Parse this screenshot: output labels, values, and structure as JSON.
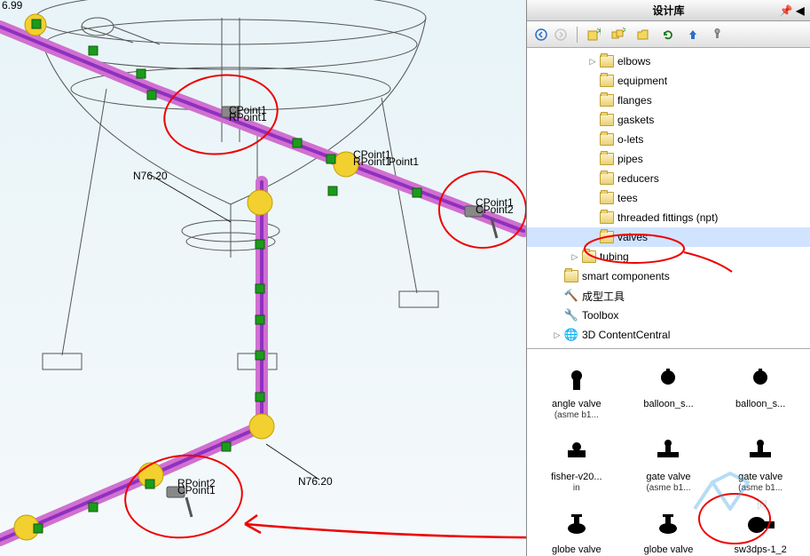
{
  "panel": {
    "title": "设计库",
    "toolbar_icons": [
      "back",
      "forward",
      "new-folder",
      "library",
      "open",
      "refresh",
      "up",
      "config"
    ]
  },
  "tree": [
    {
      "indent": 3,
      "expander": "▷",
      "icon": "folder",
      "label": "elbows"
    },
    {
      "indent": 3,
      "expander": "",
      "icon": "folder",
      "label": "equipment"
    },
    {
      "indent": 3,
      "expander": "",
      "icon": "folder",
      "label": "flanges"
    },
    {
      "indent": 3,
      "expander": "",
      "icon": "folder",
      "label": "gaskets"
    },
    {
      "indent": 3,
      "expander": "",
      "icon": "folder",
      "label": "o-lets"
    },
    {
      "indent": 3,
      "expander": "",
      "icon": "folder",
      "label": "pipes"
    },
    {
      "indent": 3,
      "expander": "",
      "icon": "folder",
      "label": "reducers"
    },
    {
      "indent": 3,
      "expander": "",
      "icon": "folder",
      "label": "tees"
    },
    {
      "indent": 3,
      "expander": "",
      "icon": "folder",
      "label": "threaded fittings (npt)"
    },
    {
      "indent": 3,
      "expander": "",
      "icon": "folder",
      "label": "valves",
      "selected": true
    },
    {
      "indent": 2,
      "expander": "▷",
      "icon": "folder",
      "label": "tubing"
    },
    {
      "indent": 1,
      "expander": "",
      "icon": "folder",
      "label": "smart components"
    },
    {
      "indent": 1,
      "expander": "",
      "icon": "forming",
      "label": "成型工具"
    },
    {
      "indent": 1,
      "expander": "",
      "icon": "toolbox",
      "label": "Toolbox"
    },
    {
      "indent": 1,
      "expander": "▷",
      "icon": "globe",
      "label": "3D ContentCentral"
    }
  ],
  "thumbs": [
    {
      "label": "angle valve",
      "sub": "(asme b1...",
      "glyph": "valve1"
    },
    {
      "label": "balloon_s...",
      "sub": "",
      "glyph": "valve2"
    },
    {
      "label": "balloon_s...",
      "sub": "",
      "glyph": "valve2"
    },
    {
      "label": "fisher-v20...",
      "sub": "in",
      "glyph": "valve3"
    },
    {
      "label": "gate valve",
      "sub": "(asme b1...",
      "glyph": "valve4"
    },
    {
      "label": "gate valve",
      "sub": "(asme b1...",
      "glyph": "valve4"
    },
    {
      "label": "globe valve",
      "sub": "",
      "glyph": "valve5"
    },
    {
      "label": "globe valve",
      "sub": "",
      "glyph": "valve5"
    },
    {
      "label": "sw3dps-1_2",
      "sub": "",
      "glyph": "valve6"
    }
  ],
  "viewport": {
    "point_labels": [
      "CPoint1",
      "CPoint2",
      "RPoint1",
      "Point1"
    ],
    "dim_labels": [
      "N76.20",
      "N76.20"
    ],
    "coord_label": "6.99"
  },
  "watermark": "网"
}
